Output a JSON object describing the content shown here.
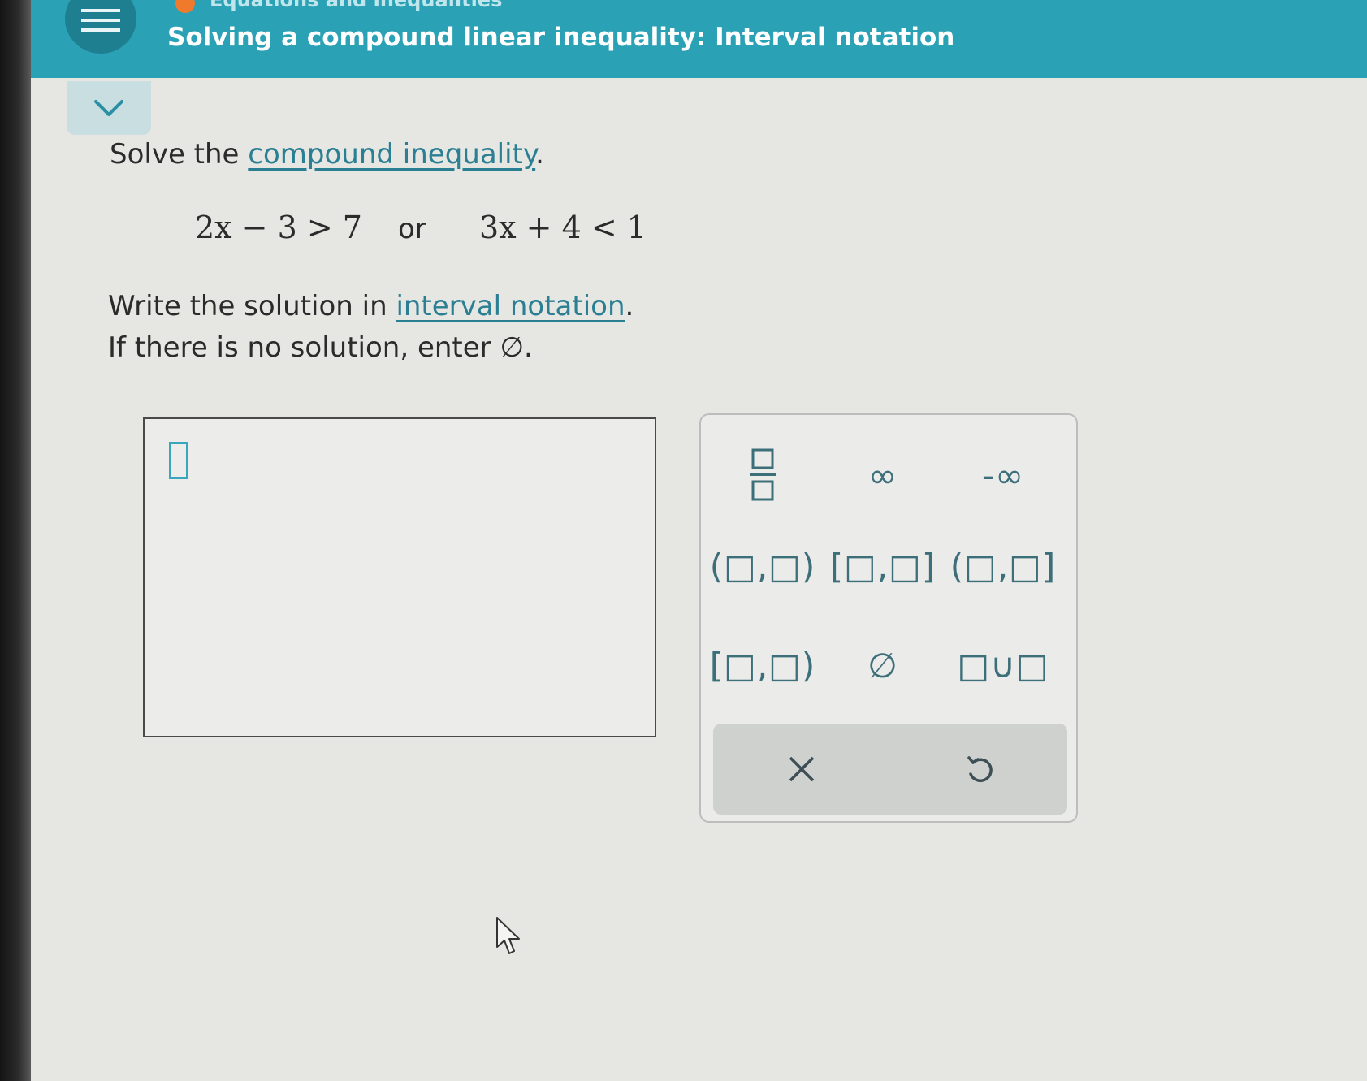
{
  "header": {
    "topic": "Equations and inequalities",
    "title": "Solving a compound linear inequality: Interval notation"
  },
  "question": {
    "prompt_before": "Solve the ",
    "prompt_link": "compound inequality",
    "prompt_after": ".",
    "inequality_left": "2x − 3 > 7",
    "connector": "or",
    "inequality_right": "3x + 4 < 1",
    "instruction_before": "Write the solution in ",
    "instruction_link": "interval notation",
    "instruction_after": ".",
    "no_solution_text": "If there is no solution, enter ∅."
  },
  "keypad": {
    "keys": [
      {
        "name": "fraction",
        "label": "□/□"
      },
      {
        "name": "infinity",
        "label": "∞"
      },
      {
        "name": "negative-infinity",
        "label": "-∞"
      },
      {
        "name": "open-open",
        "label": "(□,□)"
      },
      {
        "name": "closed-closed",
        "label": "[□,□]"
      },
      {
        "name": "open-closed",
        "label": "(□,□]"
      },
      {
        "name": "closed-open",
        "label": "[□,□)"
      },
      {
        "name": "empty-set",
        "label": "∅"
      },
      {
        "name": "union",
        "label": "□∪□"
      }
    ],
    "clear_icon": "x-icon",
    "undo_icon": "undo-icon"
  },
  "colors": {
    "header": "#2aa1b4",
    "link": "#2a7f93",
    "keypad_symbols": "#3d6f7a",
    "answer_cursor": "#3aa6bb"
  }
}
